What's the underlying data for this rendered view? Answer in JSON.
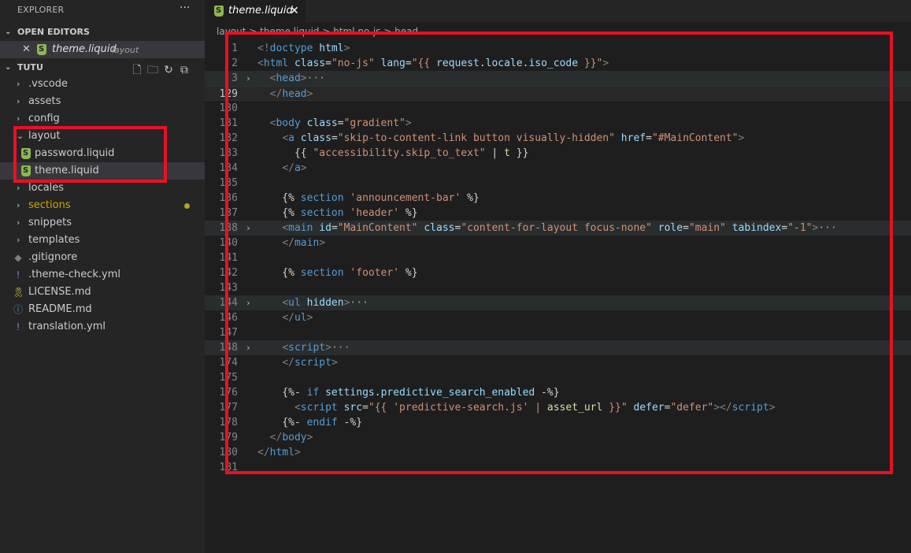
{
  "sidebar": {
    "title": "EXPLORER",
    "more_icon": "ellipsis-icon",
    "open_editors": {
      "header": "OPEN EDITORS",
      "items": [
        {
          "name": "theme.liquid",
          "dir": "layout",
          "icon": "shopify-icon"
        }
      ]
    },
    "workspace": {
      "header": "TUTU",
      "actions": [
        "new-file-icon",
        "new-folder-icon",
        "refresh-icon",
        "collapse-all-icon"
      ],
      "items": [
        {
          "label": ".vscode",
          "type": "folder",
          "expanded": false
        },
        {
          "label": "assets",
          "type": "folder",
          "expanded": false
        },
        {
          "label": "config",
          "type": "folder",
          "expanded": false
        },
        {
          "label": "layout",
          "type": "folder",
          "expanded": true
        },
        {
          "label": "password.liquid",
          "type": "file",
          "icon": "shopify-icon",
          "depth": 1
        },
        {
          "label": "theme.liquid",
          "type": "file",
          "icon": "shopify-icon",
          "depth": 1,
          "selected": true
        },
        {
          "label": "locales",
          "type": "folder",
          "expanded": false
        },
        {
          "label": "sections",
          "type": "folder",
          "expanded": false,
          "modified": true
        },
        {
          "label": "snippets",
          "type": "folder",
          "expanded": false
        },
        {
          "label": "templates",
          "type": "folder",
          "expanded": false
        },
        {
          "label": ".gitignore",
          "type": "file",
          "icon": "git-icon"
        },
        {
          "label": ".theme-check.yml",
          "type": "file",
          "icon": "yaml-icon"
        },
        {
          "label": "LICENSE.md",
          "type": "file",
          "icon": "license-icon"
        },
        {
          "label": "README.md",
          "type": "file",
          "icon": "info-icon"
        },
        {
          "label": "translation.yml",
          "type": "file",
          "icon": "yaml-icon"
        }
      ]
    }
  },
  "tabs": [
    {
      "label": "theme.liquid",
      "active": true,
      "icon": "shopify-icon"
    }
  ],
  "breadcrumb": "layout > theme.liquid > html.no-js > head",
  "colors": {
    "accent_red": "#e81123",
    "sections_color": "#cca700",
    "shopify_green": "#8cb84f"
  },
  "editor": {
    "lines": [
      {
        "n": "1",
        "fold": "",
        "code": [
          [
            "t-br",
            "<!"
          ],
          [
            "t-tag",
            "doctype"
          ],
          [
            "t-plain",
            " "
          ],
          [
            "t-attr",
            "html"
          ],
          [
            "t-br",
            ">"
          ]
        ]
      },
      {
        "n": "2",
        "fold": "",
        "code": [
          [
            "t-br",
            "<"
          ],
          [
            "t-tag",
            "html"
          ],
          [
            "t-plain",
            " "
          ],
          [
            "t-attr",
            "class"
          ],
          [
            "t-plain",
            "="
          ],
          [
            "t-str",
            "\"no-js\""
          ],
          [
            "t-plain",
            " "
          ],
          [
            "t-attr",
            "lang"
          ],
          [
            "t-plain",
            "="
          ],
          [
            "t-str",
            "\"{{ "
          ],
          [
            "t-var",
            "request"
          ],
          [
            "t-plain",
            "."
          ],
          [
            "t-var",
            "locale"
          ],
          [
            "t-plain",
            "."
          ],
          [
            "t-var",
            "iso_code"
          ],
          [
            "t-str",
            " }}\""
          ],
          [
            "t-br",
            ">"
          ]
        ]
      },
      {
        "n": "3",
        "fold": "›",
        "hl": true,
        "code": [
          [
            "t-plain",
            "  "
          ],
          [
            "t-br",
            "<"
          ],
          [
            "t-tag",
            "head"
          ],
          [
            "t-br",
            ">"
          ],
          [
            "t-ell",
            "···"
          ]
        ]
      },
      {
        "n": "129",
        "fold": "",
        "cur": true,
        "code": [
          [
            "t-plain",
            "  "
          ],
          [
            "t-br",
            "</"
          ],
          [
            "t-tag",
            "head"
          ],
          [
            "t-br",
            ">"
          ]
        ]
      },
      {
        "n": "130",
        "fold": "",
        "code": []
      },
      {
        "n": "131",
        "fold": "",
        "code": [
          [
            "t-plain",
            "  "
          ],
          [
            "t-br",
            "<"
          ],
          [
            "t-tag",
            "body"
          ],
          [
            "t-plain",
            " "
          ],
          [
            "t-attr",
            "class"
          ],
          [
            "t-plain",
            "="
          ],
          [
            "t-str",
            "\"gradient\""
          ],
          [
            "t-br",
            ">"
          ]
        ]
      },
      {
        "n": "132",
        "fold": "",
        "code": [
          [
            "t-plain",
            "    "
          ],
          [
            "t-br",
            "<"
          ],
          [
            "t-tag",
            "a"
          ],
          [
            "t-plain",
            " "
          ],
          [
            "t-attr",
            "class"
          ],
          [
            "t-plain",
            "="
          ],
          [
            "t-str",
            "\"skip-to-content-link button visually-hidden\""
          ],
          [
            "t-plain",
            " "
          ],
          [
            "t-attr",
            "href"
          ],
          [
            "t-plain",
            "="
          ],
          [
            "t-str",
            "\"#MainContent\""
          ],
          [
            "t-br",
            ">"
          ]
        ]
      },
      {
        "n": "133",
        "fold": "",
        "code": [
          [
            "t-plain",
            "      {{ "
          ],
          [
            "t-str",
            "\"accessibility.skip_to_text\""
          ],
          [
            "t-plain",
            " | "
          ],
          [
            "t-fn",
            "t"
          ],
          [
            "t-plain",
            " }}"
          ]
        ]
      },
      {
        "n": "134",
        "fold": "",
        "code": [
          [
            "t-plain",
            "    "
          ],
          [
            "t-br",
            "</"
          ],
          [
            "t-tag",
            "a"
          ],
          [
            "t-br",
            ">"
          ]
        ]
      },
      {
        "n": "135",
        "fold": "",
        "code": []
      },
      {
        "n": "136",
        "fold": "",
        "code": [
          [
            "t-plain",
            "    {% "
          ],
          [
            "t-kw",
            "section"
          ],
          [
            "t-plain",
            " "
          ],
          [
            "t-str",
            "'announcement-bar'"
          ],
          [
            "t-plain",
            " %}"
          ]
        ]
      },
      {
        "n": "137",
        "fold": "",
        "code": [
          [
            "t-plain",
            "    {% "
          ],
          [
            "t-kw",
            "section"
          ],
          [
            "t-plain",
            " "
          ],
          [
            "t-str",
            "'header'"
          ],
          [
            "t-plain",
            " %}"
          ]
        ]
      },
      {
        "n": "138",
        "fold": "›",
        "hl": true,
        "code": [
          [
            "t-plain",
            "    "
          ],
          [
            "t-br",
            "<"
          ],
          [
            "t-tag",
            "main"
          ],
          [
            "t-plain",
            " "
          ],
          [
            "t-attr",
            "id"
          ],
          [
            "t-plain",
            "="
          ],
          [
            "t-str",
            "\"MainContent\""
          ],
          [
            "t-plain",
            " "
          ],
          [
            "t-attr",
            "class"
          ],
          [
            "t-plain",
            "="
          ],
          [
            "t-str",
            "\"content-for-layout focus-none\""
          ],
          [
            "t-plain",
            " "
          ],
          [
            "t-attr",
            "role"
          ],
          [
            "t-plain",
            "="
          ],
          [
            "t-str",
            "\"main\""
          ],
          [
            "t-plain",
            " "
          ],
          [
            "t-attr",
            "tabindex"
          ],
          [
            "t-plain",
            "="
          ],
          [
            "t-str",
            "\"-1\""
          ],
          [
            "t-br",
            ">"
          ],
          [
            "t-ell",
            "···"
          ]
        ]
      },
      {
        "n": "140",
        "fold": "",
        "code": [
          [
            "t-plain",
            "    "
          ],
          [
            "t-br",
            "</"
          ],
          [
            "t-tag",
            "main"
          ],
          [
            "t-br",
            ">"
          ]
        ]
      },
      {
        "n": "141",
        "fold": "",
        "code": []
      },
      {
        "n": "142",
        "fold": "",
        "code": [
          [
            "t-plain",
            "    {% "
          ],
          [
            "t-kw",
            "section"
          ],
          [
            "t-plain",
            " "
          ],
          [
            "t-str",
            "'footer'"
          ],
          [
            "t-plain",
            " %}"
          ]
        ]
      },
      {
        "n": "143",
        "fold": "",
        "code": []
      },
      {
        "n": "144",
        "fold": "›",
        "hl": true,
        "code": [
          [
            "t-plain",
            "    "
          ],
          [
            "t-br",
            "<"
          ],
          [
            "t-tag",
            "ul"
          ],
          [
            "t-plain",
            " "
          ],
          [
            "t-attr",
            "hidden"
          ],
          [
            "t-br",
            ">"
          ],
          [
            "t-ell",
            "···"
          ]
        ]
      },
      {
        "n": "146",
        "fold": "",
        "code": [
          [
            "t-plain",
            "    "
          ],
          [
            "t-br",
            "</"
          ],
          [
            "t-tag",
            "ul"
          ],
          [
            "t-br",
            ">"
          ]
        ]
      },
      {
        "n": "147",
        "fold": "",
        "code": []
      },
      {
        "n": "148",
        "fold": "›",
        "hl": true,
        "code": [
          [
            "t-plain",
            "    "
          ],
          [
            "t-br",
            "<"
          ],
          [
            "t-tag",
            "script"
          ],
          [
            "t-br",
            ">"
          ],
          [
            "t-ell",
            "···"
          ]
        ]
      },
      {
        "n": "174",
        "fold": "",
        "code": [
          [
            "t-plain",
            "    "
          ],
          [
            "t-br",
            "</"
          ],
          [
            "t-tag",
            "script"
          ],
          [
            "t-br",
            ">"
          ]
        ]
      },
      {
        "n": "175",
        "fold": "",
        "code": []
      },
      {
        "n": "176",
        "fold": "",
        "code": [
          [
            "t-plain",
            "    {%- "
          ],
          [
            "t-kw",
            "if"
          ],
          [
            "t-plain",
            " "
          ],
          [
            "t-var",
            "settings"
          ],
          [
            "t-plain",
            "."
          ],
          [
            "t-var",
            "predictive_search_enabled"
          ],
          [
            "t-plain",
            " -%}"
          ]
        ]
      },
      {
        "n": "177",
        "fold": "",
        "code": [
          [
            "t-plain",
            "      "
          ],
          [
            "t-br",
            "<"
          ],
          [
            "t-tag",
            "script"
          ],
          [
            "t-plain",
            " "
          ],
          [
            "t-attr",
            "src"
          ],
          [
            "t-plain",
            "="
          ],
          [
            "t-str",
            "\"{{ 'predictive-search.js' | "
          ],
          [
            "t-fn",
            "asset_url"
          ],
          [
            "t-str",
            " }}\""
          ],
          [
            "t-plain",
            " "
          ],
          [
            "t-attr",
            "defer"
          ],
          [
            "t-plain",
            "="
          ],
          [
            "t-str",
            "\"defer\""
          ],
          [
            "t-br",
            "></"
          ],
          [
            "t-tag",
            "script"
          ],
          [
            "t-br",
            ">"
          ]
        ]
      },
      {
        "n": "178",
        "fold": "",
        "code": [
          [
            "t-plain",
            "    {%- "
          ],
          [
            "t-kw",
            "endif"
          ],
          [
            "t-plain",
            " -%}"
          ]
        ]
      },
      {
        "n": "179",
        "fold": "",
        "code": [
          [
            "t-plain",
            "  "
          ],
          [
            "t-br",
            "</"
          ],
          [
            "t-tag",
            "body"
          ],
          [
            "t-br",
            ">"
          ]
        ]
      },
      {
        "n": "180",
        "fold": "",
        "code": [
          [
            "t-br",
            "</"
          ],
          [
            "t-tag",
            "html"
          ],
          [
            "t-br",
            ">"
          ]
        ]
      },
      {
        "n": "181",
        "fold": "",
        "code": []
      }
    ]
  }
}
